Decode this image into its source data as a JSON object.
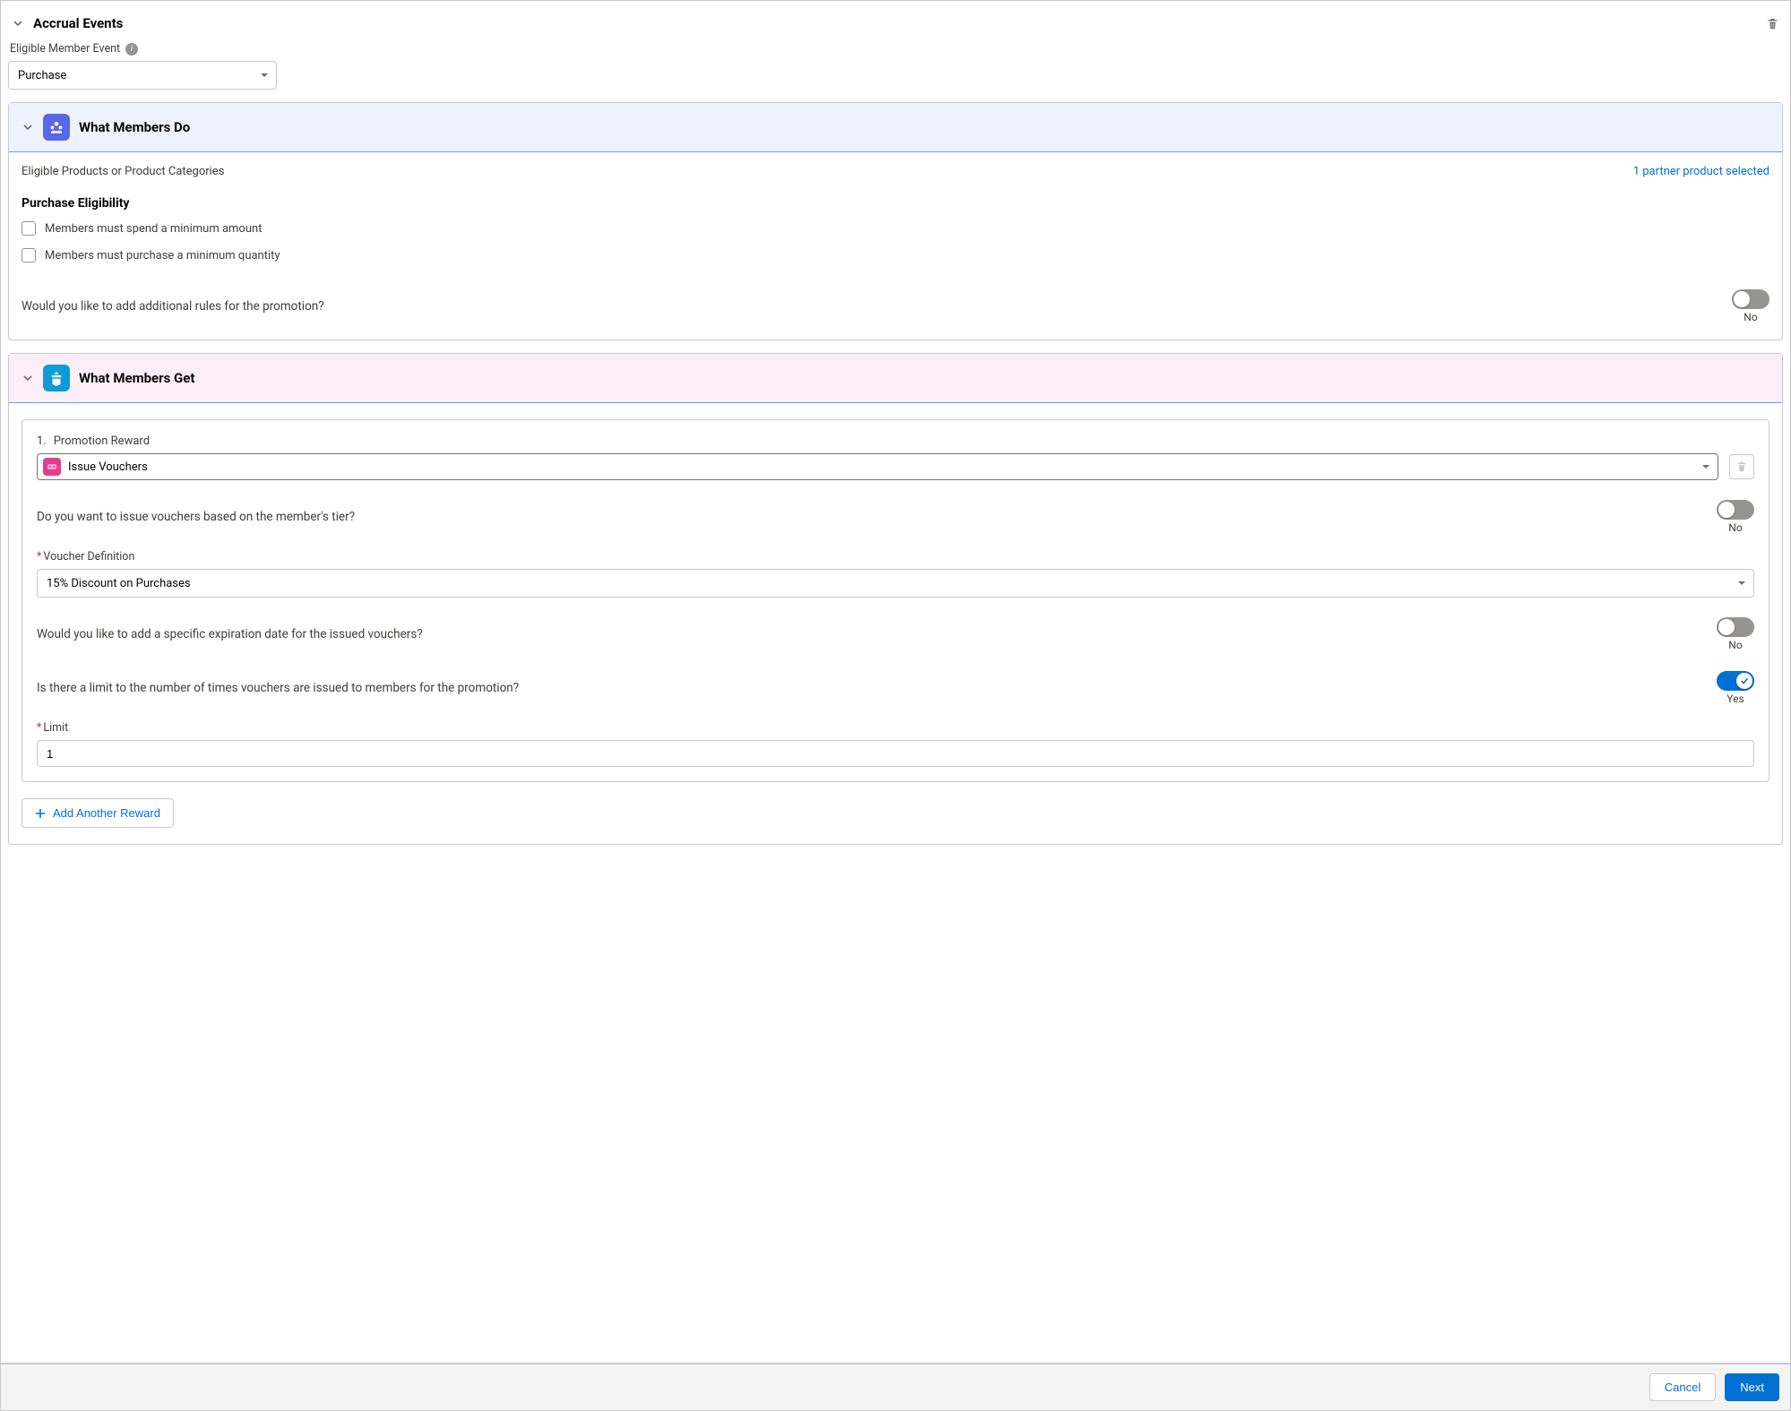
{
  "section_title": "Accrual Events",
  "eligible_event_label": "Eligible Member Event",
  "eligible_event_value": "Purchase",
  "what_members_do": {
    "title": "What Members Do",
    "products_label": "Eligible Products or Product Categories",
    "selected_link": "1 partner product selected",
    "eligibility_heading": "Purchase Eligibility",
    "cb_min_amount": "Members must spend a minimum amount",
    "cb_min_qty": "Members must purchase a minimum quantity",
    "additional_rules_q": "Would you like to add additional rules for the promotion?",
    "additional_rules_state": "No"
  },
  "what_members_get": {
    "title": "What Members Get",
    "reward_number": "1.",
    "reward_label": "Promotion Reward",
    "reward_value": "Issue Vouchers",
    "tier_q": "Do you want to issue vouchers based on the member's tier?",
    "tier_state": "No",
    "voucher_def_label": "Voucher Definition",
    "voucher_def_value": "15% Discount on Purchases",
    "expiration_q": "Would you like to add a specific expiration date for the issued vouchers?",
    "expiration_state": "No",
    "limit_q": "Is there a limit to the number of times vouchers are issued to members for the promotion?",
    "limit_state": "Yes",
    "limit_label": "Limit",
    "limit_value": "1",
    "add_reward": "Add Another Reward"
  },
  "footer": {
    "cancel": "Cancel",
    "next": "Next"
  }
}
